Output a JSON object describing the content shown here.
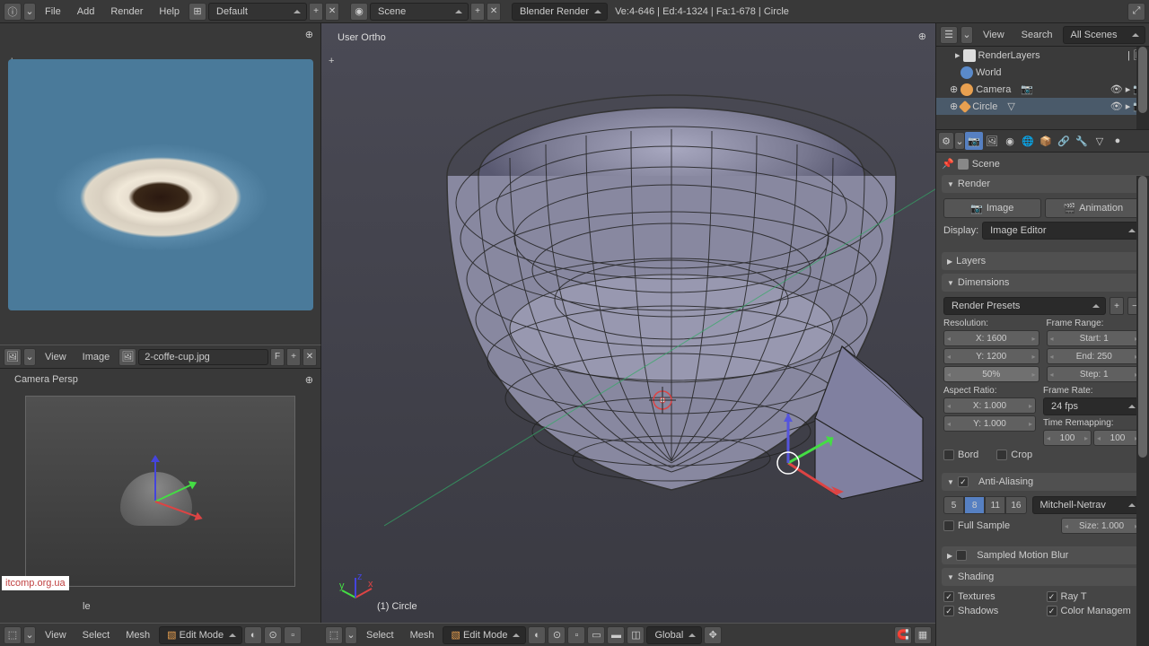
{
  "topbar": {
    "menus": [
      "File",
      "Add",
      "Render",
      "Help"
    ],
    "layout": "Default",
    "scene": "Scene",
    "engine": "Blender Render",
    "stats": "Ve:4-646 | Ed:4-1324 | Fa:1-678 | Circle"
  },
  "ref_panel": {
    "image_name": "2-coffe-cup.jpg",
    "menus": [
      "View",
      "Image"
    ],
    "f_btn": "F"
  },
  "cam_panel": {
    "label": "Camera Persp",
    "obj": "le"
  },
  "viewport": {
    "label": "User Ortho",
    "obj": "(1) Circle"
  },
  "bottombar": {
    "menus_left": [
      "View",
      "Select",
      "Mesh"
    ],
    "mode": "Edit Mode",
    "menus_center": [
      "Select",
      "Mesh"
    ],
    "mode2": "Edit Mode",
    "orient": "Global"
  },
  "outliner": {
    "menus": [
      "View",
      "Search"
    ],
    "filter": "All Scenes",
    "items": [
      {
        "name": "RenderLayers",
        "indent": 1
      },
      {
        "name": "World",
        "indent": 1
      },
      {
        "name": "Camera",
        "indent": 1
      },
      {
        "name": "Circle",
        "indent": 1
      }
    ]
  },
  "props": {
    "breadcrumb": "Scene",
    "render_hdr": "Render",
    "image_btn": "Image",
    "anim_btn": "Animation",
    "display_label": "Display:",
    "display_value": "Image Editor",
    "layers_hdr": "Layers",
    "dimensions_hdr": "Dimensions",
    "presets": "Render Presets",
    "resolution_label": "Resolution:",
    "res_x": "X: 1600",
    "res_y": "Y: 1200",
    "res_pct": "50%",
    "framerange_label": "Frame Range:",
    "frame_start": "Start: 1",
    "frame_end": "End: 250",
    "frame_step": "Step: 1",
    "aspect_label": "Aspect Ratio:",
    "aspect_x": "X: 1.000",
    "aspect_y": "Y: 1.000",
    "framerate_label": "Frame Rate:",
    "fps": "24 fps",
    "time_remap": "Time Remapping:",
    "remap_old": "100",
    "remap_new": "100",
    "bord": "Bord",
    "crop": "Crop",
    "aa_hdr": "Anti-Aliasing",
    "samples": [
      "5",
      "8",
      "11",
      "16"
    ],
    "aa_filter": "Mitchell-Netrav",
    "full_sample": "Full Sample",
    "size_label": "Size: 1.000",
    "motion_blur_hdr": "Sampled Motion Blur",
    "shading_hdr": "Shading",
    "textures": "Textures",
    "shadows": "Shadows",
    "ray_t": "Ray T",
    "color_mgmt": "Color Managem"
  },
  "watermark": "itcomp.org.ua"
}
